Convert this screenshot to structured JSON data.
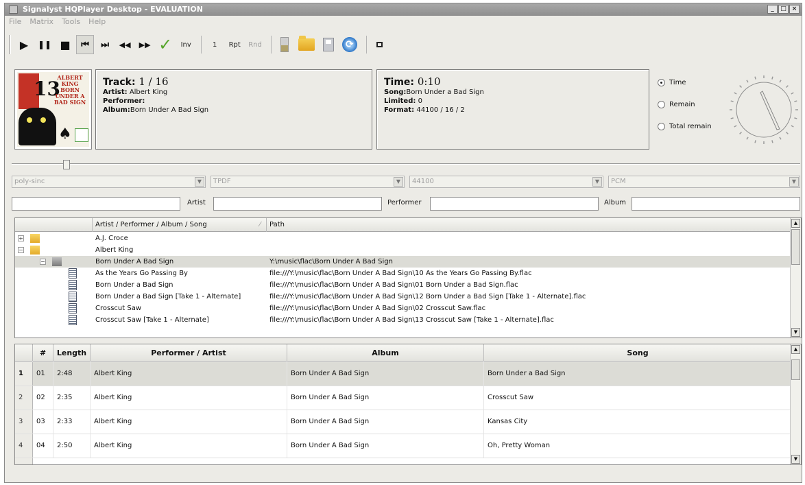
{
  "window": {
    "title": "Signalyst HQPlayer Desktop - EVALUATION",
    "controls": [
      "_",
      "□",
      "×"
    ]
  },
  "menu": [
    "File",
    "Matrix",
    "Tools",
    "Help"
  ],
  "toolbar": {
    "play": "▶",
    "pause": "❚❚",
    "stop": "■",
    "prev": "⏮",
    "next": "⏭",
    "rewind": "◀◀",
    "forward": "▶▶",
    "check": "✓",
    "inv_label": "Inv",
    "repeat_count": "1",
    "rpt_label": "Rpt",
    "rnd_label": "Rnd",
    "refresh": "⟳"
  },
  "cover": {
    "number": "13",
    "text_lines": [
      "ALBERT",
      "KING",
      "BORN",
      "UNDER A",
      "BAD SIGN"
    ]
  },
  "track_panel": {
    "track_label": "Track:",
    "track_value": "1 / 16",
    "artist_label": "Artist:",
    "artist_value": "Albert King",
    "performer_label": "Performer:",
    "performer_value": "",
    "album_label": "Album:",
    "album_value": "Born Under A Bad Sign"
  },
  "time_panel": {
    "time_label": "Time:",
    "time_value": "0:10",
    "song_label": "Song:",
    "song_value": "Born Under a Bad Sign",
    "limited_label": "Limited:",
    "limited_value": "0",
    "format_label": "Format:",
    "format_value": "44100 / 16 / 2"
  },
  "time_mode": {
    "options": [
      "Time",
      "Remain",
      "Total remain"
    ],
    "selected": 0
  },
  "seek": {
    "position_fraction": 0.066
  },
  "combos": {
    "filter": "poly-sinc",
    "dither": "TPDF",
    "rate": "44100",
    "mode": "PCM",
    "arrow": "▼"
  },
  "filters": {
    "artist_label": "Artist",
    "performer_label": "Performer",
    "album_label": "Album"
  },
  "library": {
    "columns": [
      "Artist / Performer / Album / Song",
      "Path"
    ],
    "rows": [
      {
        "name": "A.J. Croce",
        "path": ""
      },
      {
        "name": "Albert King",
        "path": ""
      },
      {
        "name": "Born Under A Bad Sign",
        "path": "Y:\\music\\flac\\Born Under A Bad Sign"
      },
      {
        "name": "As the Years Go Passing By",
        "path": "file:///Y:\\music\\flac\\Born Under A Bad Sign\\10 As the Years Go Passing By.flac"
      },
      {
        "name": "Born Under a Bad Sign",
        "path": "file:///Y:\\music\\flac\\Born Under A Bad Sign\\01 Born Under a Bad Sign.flac"
      },
      {
        "name": "Born Under a Bad Sign [Take 1 - Alternate]",
        "path": "file:///Y:\\music\\flac\\Born Under A Bad Sign\\12 Born Under a Bad Sign [Take 1 - Alternate].flac"
      },
      {
        "name": "Crosscut Saw",
        "path": "file:///Y:\\music\\flac\\Born Under A Bad Sign\\02 Crosscut Saw.flac"
      },
      {
        "name": "Crosscut Saw [Take 1 - Alternate]",
        "path": "file:///Y:\\music\\flac\\Born Under A Bad Sign\\13 Crosscut Saw [Take 1 - Alternate].flac"
      }
    ],
    "expand_plus": "+",
    "expand_minus": "−"
  },
  "playlist": {
    "columns": [
      "#",
      "Length",
      "Performer / Artist",
      "Album",
      "Song"
    ],
    "rows": [
      {
        "row": "1",
        "num": "01",
        "length": "2:48",
        "artist": "Albert King",
        "album": "Born Under A Bad Sign",
        "song": "Born Under a Bad Sign"
      },
      {
        "row": "2",
        "num": "02",
        "length": "2:35",
        "artist": "Albert King",
        "album": "Born Under A Bad Sign",
        "song": "Crosscut Saw"
      },
      {
        "row": "3",
        "num": "03",
        "length": "2:33",
        "artist": "Albert King",
        "album": "Born Under A Bad Sign",
        "song": "Kansas City"
      },
      {
        "row": "4",
        "num": "04",
        "length": "2:50",
        "artist": "Albert King",
        "album": "Born Under A Bad Sign",
        "song": "Oh, Pretty Woman"
      }
    ]
  },
  "scroll": {
    "up": "▲",
    "down": "▼"
  },
  "colors": {
    "accept_green": "#56a52b",
    "selection": "#dcdcd6",
    "folder": "#e3aa2a"
  }
}
